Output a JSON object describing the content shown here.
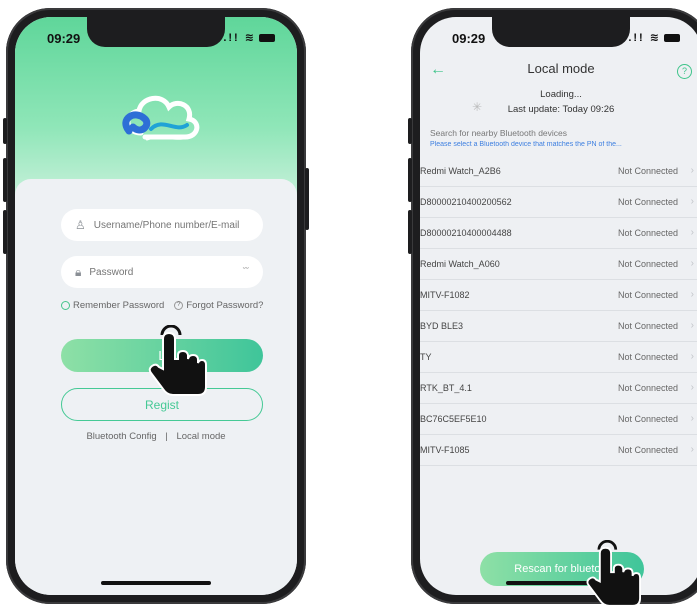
{
  "left_phone": {
    "status": {
      "time": "09:29",
      "signal": "..!!"
    },
    "username_field": {
      "placeholder": "Username/Phone number/E-mail"
    },
    "password_field": {
      "placeholder": "Password",
      "eye_glyph": "˘˘"
    },
    "remember_label": "Remember Password",
    "forgot_label": "Forgot Password?",
    "login_label": "L",
    "register_label": "Regist",
    "links": {
      "bluetooth_config": "Bluetooth Config",
      "separator": "|",
      "local_mode": "Local mode"
    }
  },
  "right_phone": {
    "status": {
      "time": "09:29",
      "signal": "..!!"
    },
    "header": {
      "title": "Local mode",
      "help": "?"
    },
    "loading_text": "Loading...",
    "last_update": "Last update: Today 09:26",
    "search_hint": "Search for nearby Bluetooth devices",
    "select_hint": "Please select a Bluetooth device that matches the PN of the...",
    "devices": [
      {
        "name": "Redmi Watch_A2B6",
        "status": "Not Connected"
      },
      {
        "name": "D80000210400200562",
        "status": "Not Connected"
      },
      {
        "name": "D80000210400004488",
        "status": "Not Connected"
      },
      {
        "name": "Redmi Watch_A060",
        "status": "Not Connected"
      },
      {
        "name": "MITV-F1082",
        "status": "Not Connected"
      },
      {
        "name": "BYD BLE3",
        "status": "Not Connected"
      },
      {
        "name": "TY",
        "status": "Not Connected"
      },
      {
        "name": "RTK_BT_4.1",
        "status": "Not Connected"
      },
      {
        "name": "BC76C5EF5E10",
        "status": "Not Connected"
      },
      {
        "name": "MITV-F1085",
        "status": "Not Connected"
      }
    ],
    "rescan_label": "Rescan for bluetoot"
  },
  "colors": {
    "accent": "#45c995",
    "link_blue": "#3d7fe0",
    "phone_frame": "#1d1d1f"
  }
}
